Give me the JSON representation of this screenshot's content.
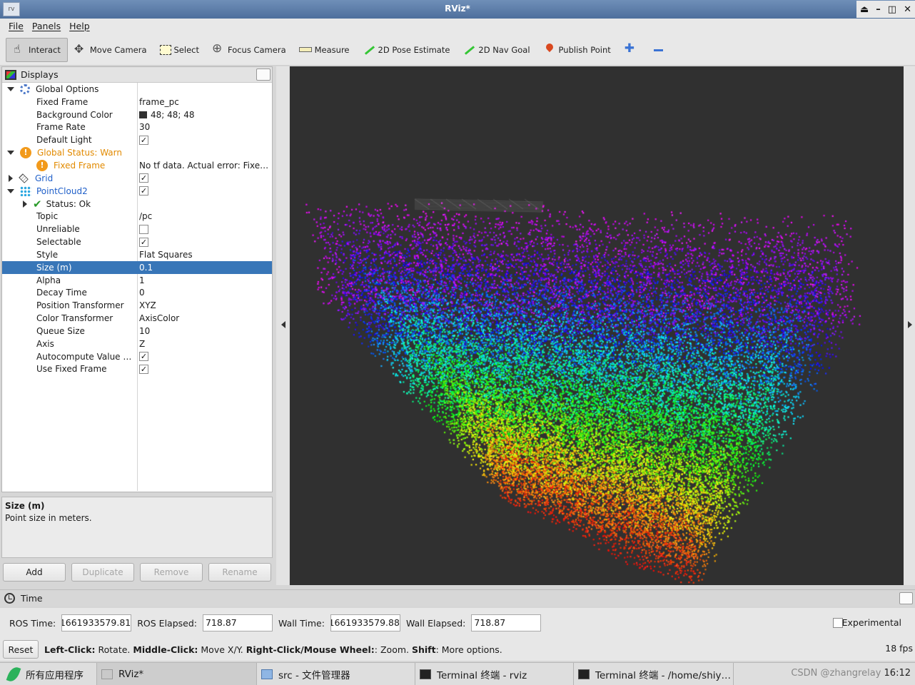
{
  "window": {
    "title": "RViz*",
    "app_icon": "rv",
    "controls": [
      "⏏",
      "–",
      "◫",
      "✕"
    ]
  },
  "menu": [
    "File",
    "Panels",
    "Help"
  ],
  "toolbar": [
    {
      "label": "Interact",
      "icon": "hand-icon",
      "active": true
    },
    {
      "label": "Move Camera",
      "icon": "move-camera-icon"
    },
    {
      "label": "Select",
      "icon": "select-icon"
    },
    {
      "label": "Focus Camera",
      "icon": "focus-camera-icon"
    },
    {
      "label": "Measure",
      "icon": "measure-icon"
    },
    {
      "label": "2D Pose Estimate",
      "icon": "pose-arrow-icon"
    },
    {
      "label": "2D Nav Goal",
      "icon": "nav-arrow-icon"
    },
    {
      "label": "Publish Point",
      "icon": "map-pin-icon"
    }
  ],
  "displays": {
    "title": "Displays",
    "rows": [
      {
        "name": "Global Options",
        "value": "",
        "indent": 0,
        "expander": "down",
        "icon": "gear"
      },
      {
        "name": "Fixed Frame",
        "value": "frame_pc",
        "indent": 1
      },
      {
        "name": "Background Color",
        "value": "48; 48; 48",
        "indent": 1,
        "swatch": "#303030"
      },
      {
        "name": "Frame Rate",
        "value": "30",
        "indent": 1
      },
      {
        "name": "Default Light",
        "value": "",
        "indent": 1,
        "checkbox": true
      },
      {
        "name": "Global Status: Warn",
        "value": "",
        "indent": 0,
        "expander": "down",
        "icon": "warn",
        "cls": "warn"
      },
      {
        "name": "Fixed Frame",
        "value": "No tf data.  Actual error: Fixe…",
        "indent": 1,
        "icon": "warn",
        "cls": "warn"
      },
      {
        "name": "Grid",
        "value": "",
        "indent": 0,
        "expander": "right",
        "icon": "grid",
        "cls": "blue",
        "checkbox": true
      },
      {
        "name": "PointCloud2",
        "value": "",
        "indent": 0,
        "expander": "down",
        "icon": "cloud",
        "cls": "blue",
        "checkbox": true
      },
      {
        "name": "Status: Ok",
        "value": "",
        "indent": 1,
        "expander": "right",
        "icon": "check"
      },
      {
        "name": "Topic",
        "value": "/pc",
        "indent": 1
      },
      {
        "name": "Unreliable",
        "value": "",
        "indent": 1,
        "checkbox": false
      },
      {
        "name": "Selectable",
        "value": "",
        "indent": 1,
        "checkbox": true
      },
      {
        "name": "Style",
        "value": "Flat Squares",
        "indent": 1
      },
      {
        "name": "Size (m)",
        "value": "0.1",
        "indent": 1,
        "selected": true
      },
      {
        "name": "Alpha",
        "value": "1",
        "indent": 1
      },
      {
        "name": "Decay Time",
        "value": "0",
        "indent": 1
      },
      {
        "name": "Position Transformer",
        "value": "XYZ",
        "indent": 1
      },
      {
        "name": "Color Transformer",
        "value": "AxisColor",
        "indent": 1
      },
      {
        "name": "Queue Size",
        "value": "10",
        "indent": 1
      },
      {
        "name": "Axis",
        "value": "Z",
        "indent": 1
      },
      {
        "name": "Autocompute Value …",
        "value": "",
        "indent": 1,
        "checkbox": true
      },
      {
        "name": "Use Fixed Frame",
        "value": "",
        "indent": 1,
        "checkbox": true
      }
    ]
  },
  "description": {
    "title": "Size (m)",
    "text": "Point size in meters."
  },
  "panel_buttons": [
    {
      "label": "Add",
      "enabled": true
    },
    {
      "label": "Duplicate",
      "enabled": false
    },
    {
      "label": "Remove",
      "enabled": false
    },
    {
      "label": "Rename",
      "enabled": false
    }
  ],
  "viewport": {
    "background": "#303030"
  },
  "time": {
    "title": "Time",
    "ros_time_label": "ROS Time:",
    "ros_time": "1661933579.81",
    "ros_elapsed_label": "ROS Elapsed:",
    "ros_elapsed": "718.87",
    "wall_time_label": "Wall Time:",
    "wall_time": "1661933579.88",
    "wall_elapsed_label": "Wall Elapsed:",
    "wall_elapsed": "718.87",
    "experimental_label": "Experimental"
  },
  "status": {
    "reset": "Reset",
    "help": [
      {
        "b": "Left-Click:",
        "t": " Rotate. "
      },
      {
        "b": "Middle-Click:",
        "t": " Move X/Y. "
      },
      {
        "b": "Right-Click/Mouse Wheel:",
        "t": ": Zoom. "
      },
      {
        "b": "Shift",
        "t": ": More options."
      }
    ],
    "fps": "18 fps"
  },
  "taskbar": {
    "start": "所有应用程序",
    "tasks": [
      "RViz*",
      "src - 文件管理器",
      "Terminal 终端 - rviz",
      "Terminal 终端 - /home/shiy…"
    ],
    "watermark": "CSDN @zhangrelay",
    "clock": "16:12"
  }
}
